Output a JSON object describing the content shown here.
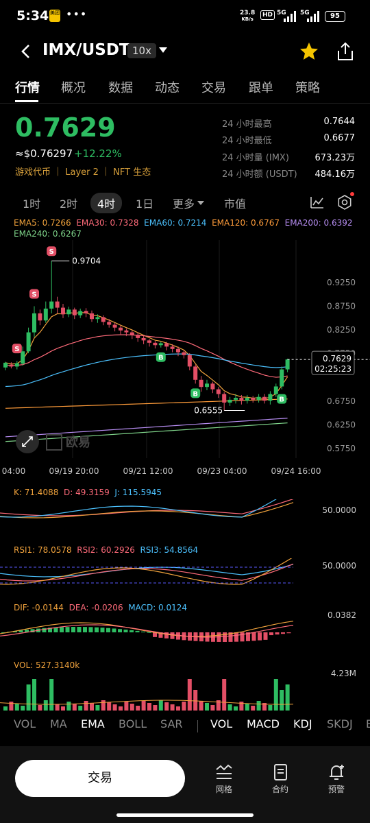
{
  "status": {
    "time": "5:34",
    "badge": "美团",
    "dots": "•••",
    "speed": "23.8",
    "speed_unit": "KB/s",
    "hd": "HD",
    "sig1": "5G",
    "sig2": "5G",
    "battery": "95"
  },
  "header": {
    "pair": "IMX/USDT",
    "leverage": "10x"
  },
  "tabs": [
    "行情",
    "概况",
    "数据",
    "动态",
    "交易",
    "跟单",
    "策略"
  ],
  "price": {
    "last": "0.7629",
    "usd": "≈$0.76297",
    "change": "+12.22%",
    "tags": "游戏代币 ｜ Layer 2 ｜ NFT 生态",
    "stats": [
      {
        "label": "24 小时最高",
        "value": "0.7644"
      },
      {
        "label": "24 小时最低",
        "value": "0.6677"
      },
      {
        "label": "24 小时量 (IMX)",
        "value": "673.23万"
      },
      {
        "label": "24 小时额 (USDT)",
        "value": "484.16万"
      }
    ]
  },
  "intervals": {
    "i1": "1时",
    "i2": "2时",
    "i3": "4时",
    "i4": "1日",
    "more": "更多",
    "mcap": "市值"
  },
  "ema": {
    "ema5": "EMA5: 0.7266",
    "ema30": "EMA30: 0.7328",
    "ema60": "EMA60: 0.7214",
    "ema120": "EMA120: 0.6767",
    "ema200": "EMA200: 0.6392",
    "ema240": "EMA240: 0.6267"
  },
  "chart_data": {
    "type": "candlestick",
    "y_ticks": [
      "0.9250",
      "0.8750",
      "0.8250",
      "0.7750",
      "0.6750",
      "0.6250",
      "0.5750"
    ],
    "ylim": [
      0.555,
      1.0
    ],
    "x_ticks": [
      "04:00",
      "09/19 20:00",
      "09/21 12:00",
      "09/23 04:00",
      "09/24 16:00"
    ],
    "high_marker": "0.9704",
    "low_marker": "0.6555",
    "last_label": "0.7629",
    "countdown": "02:25:23",
    "sell_marker": "S",
    "buy_marker": "B",
    "watermark": "欧易",
    "candles": [
      [
        0.746,
        0.756,
        0.74,
        0.758
      ],
      [
        0.752,
        0.748,
        0.744,
        0.757
      ],
      [
        0.748,
        0.755,
        0.742,
        0.76
      ],
      [
        0.754,
        0.78,
        0.75,
        0.79
      ],
      [
        0.78,
        0.82,
        0.776,
        0.83
      ],
      [
        0.82,
        0.86,
        0.81,
        0.875
      ],
      [
        0.86,
        0.845,
        0.835,
        0.868
      ],
      [
        0.845,
        0.87,
        0.84,
        0.885
      ],
      [
        0.87,
        0.885,
        0.86,
        0.9704
      ],
      [
        0.885,
        0.872,
        0.86,
        0.895
      ],
      [
        0.872,
        0.858,
        0.85,
        0.88
      ],
      [
        0.858,
        0.868,
        0.852,
        0.874
      ],
      [
        0.868,
        0.856,
        0.848,
        0.872
      ],
      [
        0.856,
        0.865,
        0.85,
        0.87
      ],
      [
        0.865,
        0.86,
        0.852,
        0.871
      ],
      [
        0.86,
        0.848,
        0.842,
        0.866
      ],
      [
        0.848,
        0.852,
        0.84,
        0.858
      ],
      [
        0.852,
        0.842,
        0.835,
        0.856
      ],
      [
        0.842,
        0.836,
        0.83,
        0.848
      ],
      [
        0.836,
        0.83,
        0.822,
        0.84
      ],
      [
        0.83,
        0.824,
        0.816,
        0.834
      ],
      [
        0.824,
        0.82,
        0.812,
        0.828
      ],
      [
        0.82,
        0.815,
        0.806,
        0.824
      ],
      [
        0.815,
        0.808,
        0.8,
        0.82
      ],
      [
        0.808,
        0.803,
        0.795,
        0.813
      ],
      [
        0.803,
        0.798,
        0.79,
        0.806
      ],
      [
        0.798,
        0.793,
        0.786,
        0.802
      ],
      [
        0.793,
        0.797,
        0.788,
        0.8
      ],
      [
        0.797,
        0.79,
        0.782,
        0.8
      ],
      [
        0.79,
        0.785,
        0.778,
        0.795
      ],
      [
        0.785,
        0.778,
        0.77,
        0.79
      ],
      [
        0.778,
        0.772,
        0.765,
        0.783
      ],
      [
        0.772,
        0.748,
        0.74,
        0.776
      ],
      [
        0.748,
        0.72,
        0.712,
        0.752
      ],
      [
        0.72,
        0.705,
        0.695,
        0.728
      ],
      [
        0.705,
        0.712,
        0.698,
        0.72
      ],
      [
        0.712,
        0.7,
        0.692,
        0.716
      ],
      [
        0.7,
        0.69,
        0.682,
        0.705
      ],
      [
        0.69,
        0.672,
        0.6555,
        0.694
      ],
      [
        0.672,
        0.678,
        0.665,
        0.684
      ],
      [
        0.678,
        0.682,
        0.67,
        0.69
      ],
      [
        0.682,
        0.676,
        0.668,
        0.688
      ],
      [
        0.676,
        0.682,
        0.67,
        0.688
      ],
      [
        0.682,
        0.678,
        0.672,
        0.686
      ],
      [
        0.678,
        0.684,
        0.672,
        0.69
      ],
      [
        0.684,
        0.676,
        0.67,
        0.69
      ],
      [
        0.676,
        0.69,
        0.668,
        0.696
      ],
      [
        0.69,
        0.706,
        0.684,
        0.712
      ],
      [
        0.706,
        0.742,
        0.7,
        0.748
      ],
      [
        0.742,
        0.7629,
        0.736,
        0.7644
      ]
    ]
  },
  "kdj": {
    "k": "K: 71.4088",
    "d": "D: 49.3159",
    "j": "J: 115.5945",
    "tick": "50.0000"
  },
  "rsi": {
    "r1": "RSI1: 78.0578",
    "r2": "RSI2: 60.2926",
    "r3": "RSI3: 54.8564",
    "tick": "50.0000"
  },
  "macd": {
    "dif": "DIF: -0.0144",
    "dea": "DEA: -0.0206",
    "macd": "MACD: 0.0124",
    "tick": "0.0382"
  },
  "vol": {
    "label": "VOL: 527.3140k",
    "tick": "4.23M"
  },
  "selectors": [
    "VOL",
    "MA",
    "EMA",
    "BOLL",
    "SAR",
    "VOL",
    "MACD",
    "KDJ",
    "SKDJ",
    "B"
  ],
  "bottom": {
    "trade": "交易",
    "grid": "网格",
    "contract": "合约",
    "alert": "预警"
  },
  "colors": {
    "up": "#2ebd62",
    "down": "#e34f66",
    "accent": "#f5c400"
  }
}
